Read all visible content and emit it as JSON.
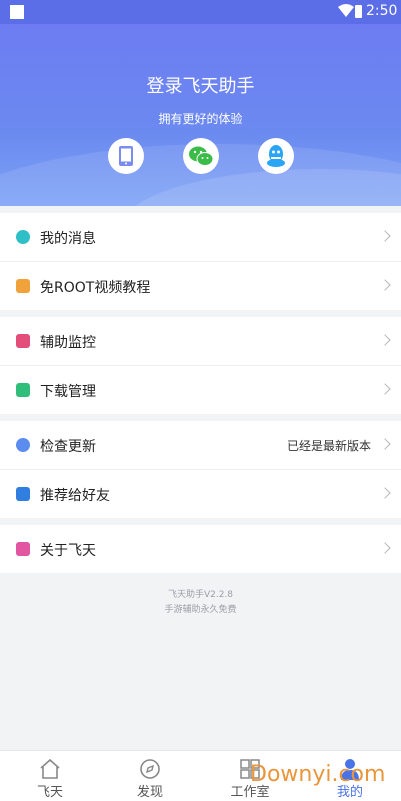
{
  "status_bar": {
    "time": "2:50"
  },
  "header": {
    "title": "登录飞天助手",
    "subtitle": "拥有更好的体验",
    "login_icons": [
      "phone-icon",
      "wechat-icon",
      "qq-icon"
    ]
  },
  "menu": {
    "messages": "我的消息",
    "root_tutorial": "免ROOT视频教程",
    "monitor": "辅助监控",
    "downloads": "下载管理",
    "check_update": "检查更新",
    "check_update_value": "已经是最新版本",
    "recommend": "推荐给好友",
    "about": "关于飞天"
  },
  "version": {
    "line1": "飞天助手V2.2.8",
    "line2": "手游辅助永久免费"
  },
  "tabs": [
    {
      "label": "飞天",
      "icon": "home-icon"
    },
    {
      "label": "发现",
      "icon": "compass-icon"
    },
    {
      "label": "工作室",
      "icon": "grid-icon"
    },
    {
      "label": "我的",
      "icon": "person-icon",
      "active": true
    }
  ],
  "watermark": "Downyi.com",
  "colors": {
    "header_top": "#6d7cf2",
    "accent": "#4a73e8",
    "messages_icon": "#2ec0c6",
    "tutorial_icon": "#f2a23b",
    "monitor_icon": "#e24d79",
    "downloads_icon": "#2fbf7a",
    "update_icon": "#5b8df0",
    "share_icon": "#2f7ee0",
    "about_icon": "#e255a0"
  }
}
